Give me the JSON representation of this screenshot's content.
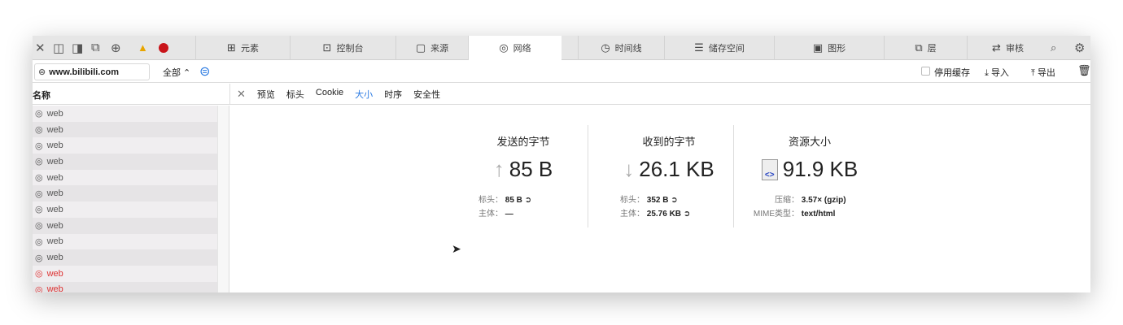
{
  "toolbar": {
    "tabs": [
      {
        "label": "元素",
        "icon": "elements-icon"
      },
      {
        "label": "控制台",
        "icon": "console-icon"
      },
      {
        "label": "来源",
        "icon": "sources-icon"
      },
      {
        "label": "网络",
        "icon": "network-icon"
      },
      {
        "label": "时间线",
        "icon": "timeline-icon"
      },
      {
        "label": "储存空间",
        "icon": "storage-icon"
      },
      {
        "label": "图形",
        "icon": "graphics-icon"
      },
      {
        "label": "层",
        "icon": "layers-icon"
      },
      {
        "label": "审核",
        "icon": "audit-icon"
      }
    ],
    "selected": "网络"
  },
  "filter": {
    "url": "www.bilibili.com",
    "type": "全部",
    "disable_cache": "停用缓存",
    "import": "导入",
    "export": "导出"
  },
  "list": {
    "header": "名称",
    "items": [
      "web",
      "web",
      "web",
      "web",
      "web",
      "web",
      "web",
      "web",
      "web",
      "web",
      "web",
      "web"
    ],
    "error_indices": [
      10,
      11
    ]
  },
  "detail": {
    "tabs": [
      "预览",
      "标头",
      "Cookie",
      "大小",
      "时序",
      "安全性"
    ],
    "selected": "大小",
    "sent": {
      "title": "发送的字节",
      "value": "85 B",
      "header_label": "标头：",
      "header_value": "85 B",
      "body_label": "主体：",
      "body_value": "—"
    },
    "received": {
      "title": "收到的字节",
      "value": "26.1 KB",
      "header_label": "标头：",
      "header_value": "352 B",
      "body_label": "主体：",
      "body_value": "25.76 KB"
    },
    "resource": {
      "title": "资源大小",
      "value": "91.9 KB",
      "compress_label": "压缩：",
      "compress_value": "3.57× (gzip)",
      "mime_label": "MIME类型：",
      "mime_value": "text/html"
    }
  },
  "colors": {
    "accent": "#2a7ae2",
    "error": "#d33"
  }
}
